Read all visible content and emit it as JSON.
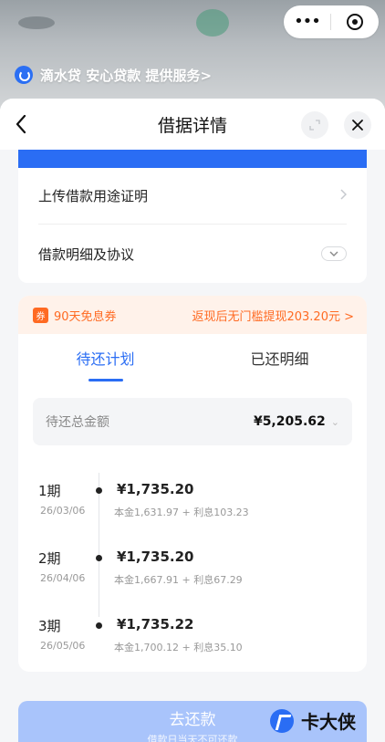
{
  "topbar": {
    "more_icon": "more-dots-icon",
    "target_icon": "target-icon"
  },
  "provider": {
    "text": "滴水贷 安心贷款 提供服务>"
  },
  "nav": {
    "title": "借据详情",
    "back_icon": "chevron-left-icon",
    "expand_icon": "expand-icon",
    "close_icon": "close-icon"
  },
  "menu": [
    {
      "label": "上传借款用途证明"
    },
    {
      "label": "借款明细及协议"
    }
  ],
  "coupon": {
    "badge": "券",
    "label": "90天免息券",
    "offer": "返现后无门槛提现203.20元 >"
  },
  "tabs": [
    {
      "label": "待还计划",
      "active": true
    },
    {
      "label": "已还明细",
      "active": false
    }
  ],
  "total": {
    "label": "待还总金额",
    "amount": "¥5,205.62"
  },
  "installments": [
    {
      "period": "1期",
      "date": "26/03/06",
      "amount": "¥1,735.20",
      "detail": "本金1,631.97 + 利息103.23"
    },
    {
      "period": "2期",
      "date": "26/04/06",
      "amount": "¥1,735.20",
      "detail": "本金1,667.91 + 利息67.29"
    },
    {
      "period": "3期",
      "date": "26/05/06",
      "amount": "¥1,735.22",
      "detail": "本金1,700.12 + 利息35.10"
    }
  ],
  "repay": {
    "label": "去还款",
    "sub": "借款日当天不可还款"
  },
  "watermark": {
    "text": "卡大侠"
  },
  "colors": {
    "brand_blue": "#2a6df4",
    "coupon_orange": "#ff6a22",
    "coupon_bg": "#fff2ea"
  }
}
